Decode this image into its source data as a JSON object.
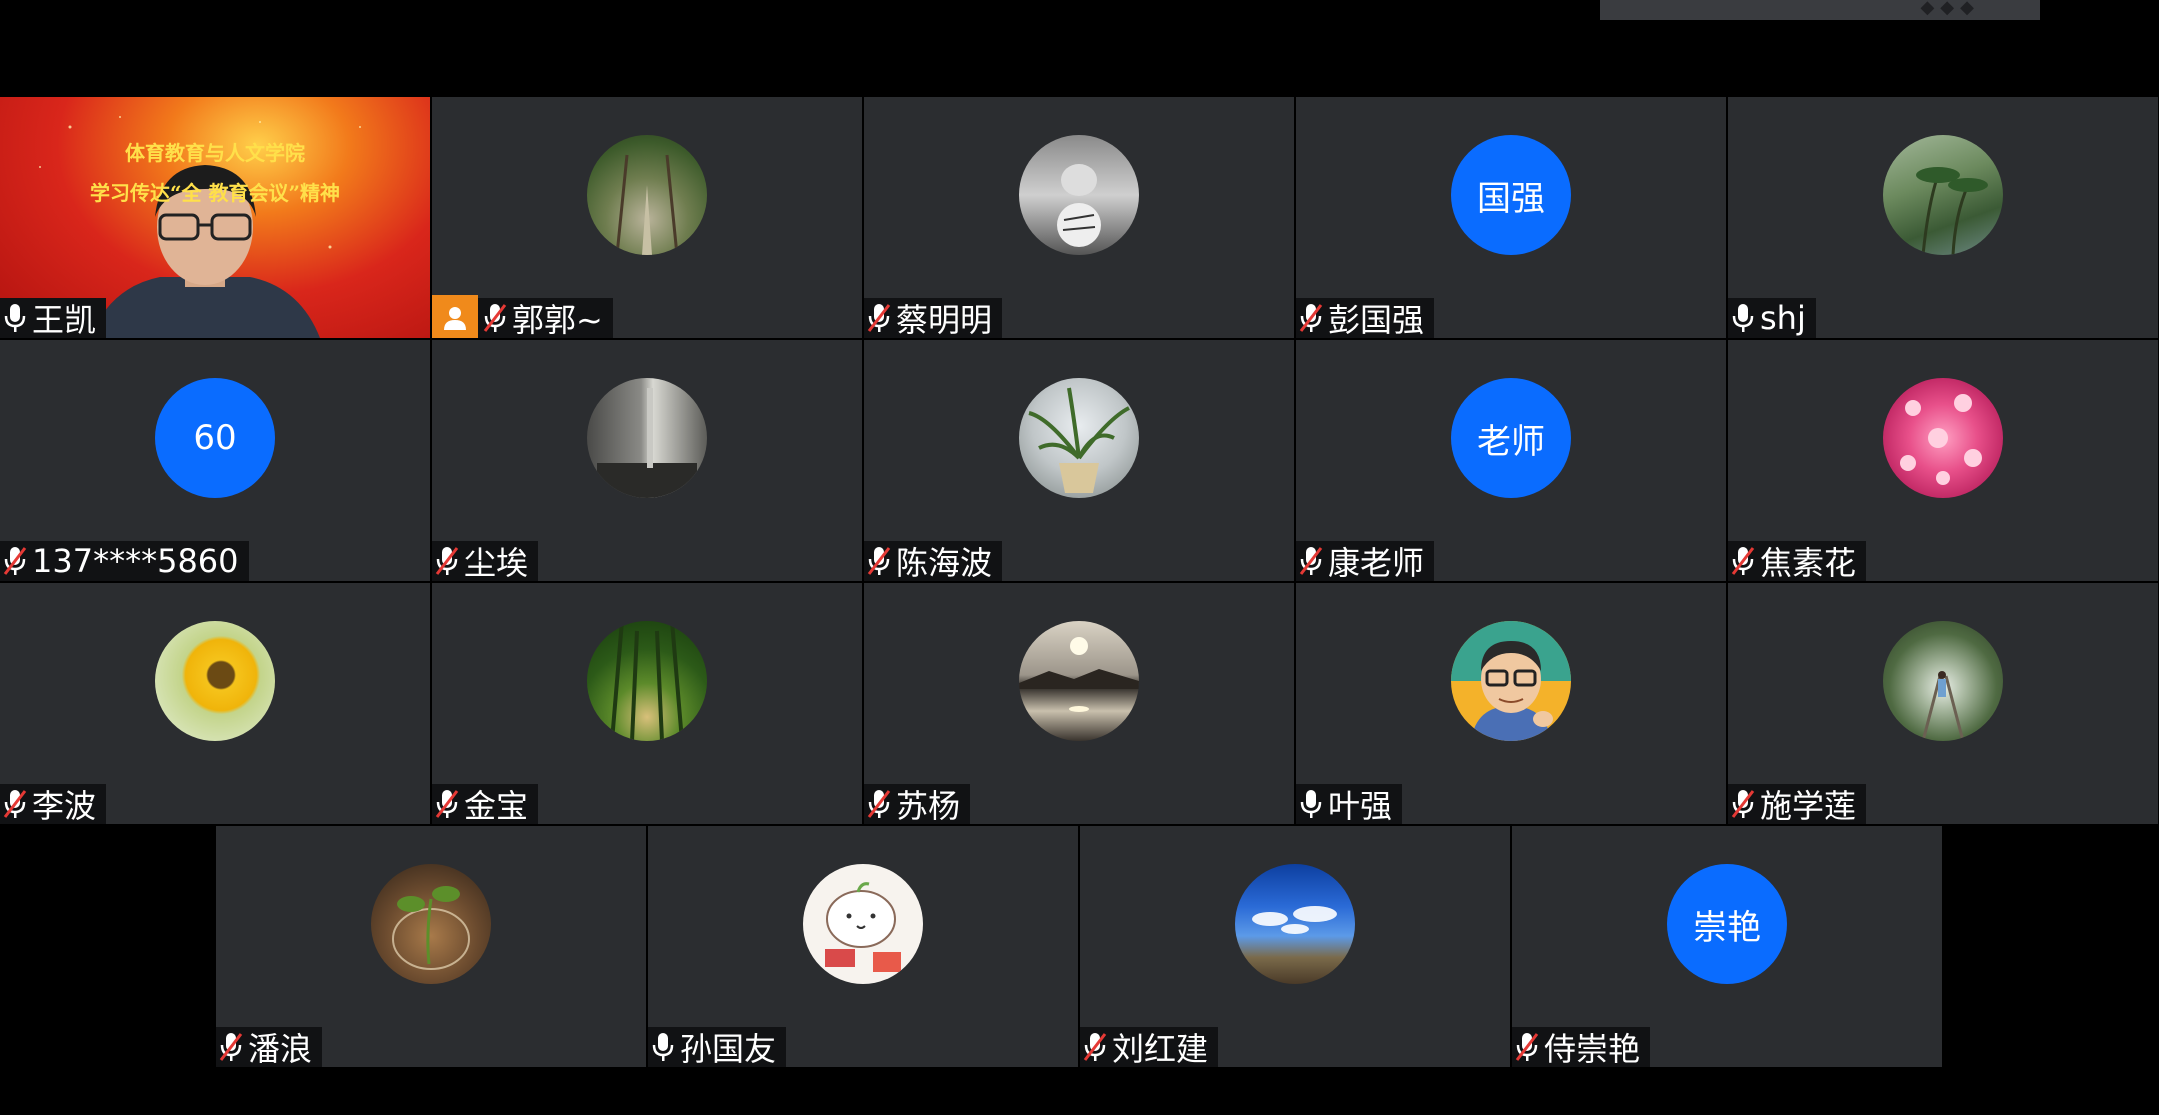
{
  "meeting": {
    "participants": [
      {
        "name": "王凯",
        "mic": "on",
        "type": "video",
        "banner_line1": "体育教育与人文学院",
        "banner_line2": "学习传达“全    教育会议”精神"
      },
      {
        "name": "郭郭~",
        "mic": "muted",
        "host": true,
        "avatar": "tree-lined-road-photo"
      },
      {
        "name": "蔡明明",
        "mic": "muted",
        "avatar": "cat-tiger-reflection-photo"
      },
      {
        "name": "彭国强",
        "mic": "muted",
        "initials": "国强"
      },
      {
        "name": "shj",
        "mic": "on",
        "avatar": "palm-trees-photo"
      },
      {
        "name": "137****5860",
        "mic": "muted",
        "initials": "60"
      },
      {
        "name": "尘埃",
        "mic": "muted",
        "avatar": "room-interior-photo"
      },
      {
        "name": "陈海波",
        "mic": "muted",
        "avatar": "potted-plant-photo"
      },
      {
        "name": "康老师",
        "mic": "muted",
        "initials": "老师"
      },
      {
        "name": "焦素花",
        "mic": "muted",
        "avatar": "pink-flowers-photo"
      },
      {
        "name": "李波",
        "mic": "muted",
        "avatar": "sunflower-photo"
      },
      {
        "name": "金宝",
        "mic": "muted",
        "avatar": "green-forest-path-photo"
      },
      {
        "name": "苏杨",
        "mic": "muted",
        "avatar": "sunset-lake-photo"
      },
      {
        "name": "叶强",
        "mic": "on",
        "avatar": "cartoon-glasses-man"
      },
      {
        "name": "施学莲",
        "mic": "muted",
        "avatar": "railway-walk-photo"
      },
      {
        "name": "潘浪",
        "mic": "muted",
        "avatar": "plant-in-glass-photo"
      },
      {
        "name": "孙国友",
        "mic": "on",
        "avatar": "cartoon-bun-character"
      },
      {
        "name": "刘红建",
        "mic": "muted",
        "avatar": "blue-sky-clouds-photo"
      },
      {
        "name": "侍崇艳",
        "mic": "muted",
        "initials": "崇艳"
      }
    ]
  },
  "colors": {
    "tile_bg": "#2b2d30",
    "initials_bg": "#0a6cff",
    "host_badge": "#f08a1b",
    "mute_slash": "#e53935"
  }
}
